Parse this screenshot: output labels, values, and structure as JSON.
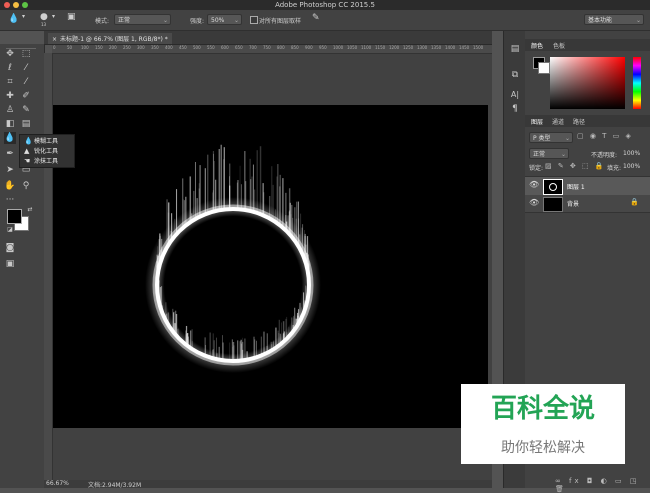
{
  "window": {
    "title": "Adobe Photoshop CC 2015.5"
  },
  "options_bar": {
    "brush_size": "13",
    "mode_label": "模式:",
    "mode_value": "正常",
    "strength_label": "强度:",
    "strength_value": "50%",
    "sample_all_label": "对所有图层取样",
    "workspace": "基本功能"
  },
  "document": {
    "tab_title": "未标题-1 @ 66.7% (图层 1, RGB/8*) *",
    "ruler_marks": [
      "0",
      "50",
      "100",
      "150",
      "200",
      "250",
      "300",
      "350",
      "400",
      "450",
      "500",
      "550",
      "600",
      "650",
      "700",
      "750",
      "800",
      "850",
      "900",
      "950",
      "1000",
      "1050",
      "1100",
      "1150",
      "1200",
      "1250",
      "1300",
      "1350",
      "1400",
      "1450",
      "1500"
    ]
  },
  "flyout": {
    "items": [
      {
        "icon": "blur-icon",
        "label": "模糊工具"
      },
      {
        "icon": "sharpen-icon",
        "label": "锐化工具"
      },
      {
        "icon": "smudge-icon",
        "label": "涂抹工具"
      }
    ]
  },
  "status": {
    "zoom": "66.67%",
    "doc_info": "文档:2.94M/3.92M"
  },
  "color_panel": {
    "tabs": [
      "颜色",
      "色板"
    ]
  },
  "layers_panel": {
    "tabs": [
      "图层",
      "通道",
      "路径"
    ],
    "filter_kind": "P 类型",
    "blend_mode": "正常",
    "opacity_label": "不透明度:",
    "opacity_value": "100%",
    "lock_label": "锁定:",
    "fill_label": "填充:",
    "fill_value": "100%",
    "layers": [
      {
        "name": "图层 1",
        "selected": true
      },
      {
        "name": "背景",
        "selected": false,
        "locked": true
      }
    ]
  },
  "watermark": {
    "title": "百科全说",
    "subtitle": "助你轻松解决"
  }
}
